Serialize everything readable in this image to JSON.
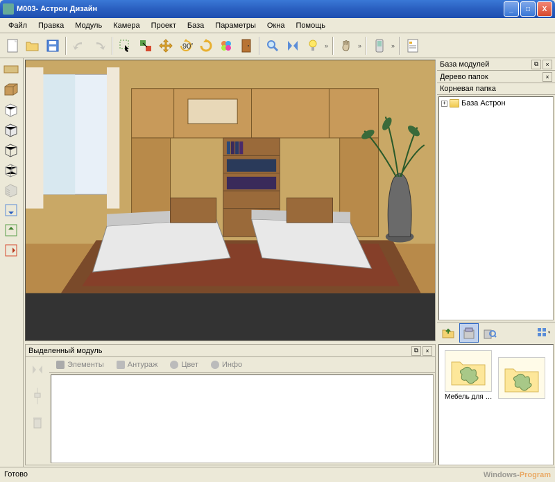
{
  "window": {
    "title": "М003- Астрон Дизайн"
  },
  "menu": {
    "items": [
      "Файл",
      "Правка",
      "Модуль",
      "Камера",
      "Проект",
      "База",
      "Параметры",
      "Окна",
      "Помощь"
    ]
  },
  "toolbar": {
    "icons": [
      "new-file",
      "open",
      "save",
      "undo",
      "redo",
      "select",
      "group-select",
      "move",
      "rotate-90",
      "rotate-free",
      "color-wheel",
      "door",
      "zoom",
      "mirror",
      "light",
      "hand",
      "phone",
      "report"
    ]
  },
  "left_tools": [
    "material-flat",
    "material-box",
    "cube",
    "cube-solid",
    "cube-line",
    "cube-wire",
    "arrow-down",
    "arrow-up",
    "arrow-right"
  ],
  "viewport": {
    "desc": "Интерьер спальни с двумя кроватями, шкафом и вазой"
  },
  "module_panel": {
    "title": "Выделенный модуль",
    "tabs": [
      "Элементы",
      "Антураж",
      "Цвет",
      "Инфо"
    ]
  },
  "right": {
    "panel1_title": "База модулей",
    "panel2_title": "Дерево папок",
    "root_label": "Корневая папка",
    "tree_item": "База Астрон",
    "thumb1_label": "Мебель для д..."
  },
  "status": {
    "text": "Готово"
  },
  "watermark": {
    "a": "Windows-",
    "b": "Program"
  }
}
